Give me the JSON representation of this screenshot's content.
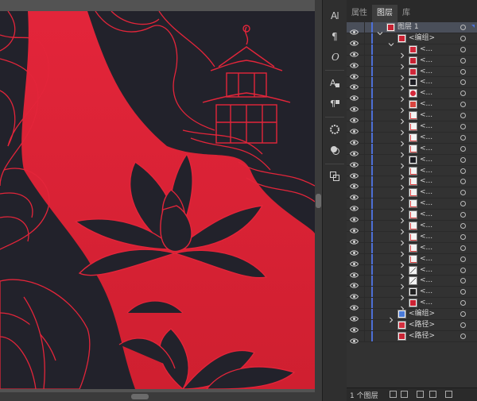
{
  "tabs": [
    {
      "label": "属性",
      "active": false
    },
    {
      "label": "图层",
      "active": true
    },
    {
      "label": "库",
      "active": false
    }
  ],
  "tools": [
    {
      "name": "character-tool-icon",
      "glyph": "A"
    },
    {
      "name": "paragraph-tool-icon",
      "glyph": "¶"
    },
    {
      "name": "opentype-tool-icon",
      "glyph": "O"
    },
    {
      "name": "char-styles-icon",
      "glyph": "A"
    },
    {
      "name": "para-styles-icon",
      "glyph": "¶"
    },
    {
      "name": "symbols-icon",
      "glyph": "✲"
    },
    {
      "name": "appearance-icon",
      "glyph": "●"
    },
    {
      "name": "transform-icon",
      "glyph": "⧉"
    }
  ],
  "layers": {
    "top_layer": {
      "label": "图层 1",
      "expanded": true
    },
    "group_top": {
      "label": "<编组>",
      "expanded": true
    },
    "sub_items": [
      {
        "label": "<...",
        "mark": "red-cloud"
      },
      {
        "label": "<...",
        "mark": "red-lotus"
      },
      {
        "label": "<...",
        "mark": "red-cloud"
      },
      {
        "label": "<...",
        "mark": "black-blob"
      },
      {
        "label": "<...",
        "mark": "red-disc"
      },
      {
        "label": "<...",
        "mark": "red-wave"
      },
      {
        "label": "<...",
        "mark": "red-sketch"
      },
      {
        "label": "<...",
        "mark": "red-sketch"
      },
      {
        "label": "<...",
        "mark": "red-sketch"
      },
      {
        "label": "<...",
        "mark": "red-sketch"
      },
      {
        "label": "<...",
        "mark": "black-blob"
      },
      {
        "label": "<...",
        "mark": "red-sketch"
      },
      {
        "label": "<...",
        "mark": "red-sketch"
      },
      {
        "label": "<...",
        "mark": "red-sketch"
      },
      {
        "label": "<...",
        "mark": "red-sketch"
      },
      {
        "label": "<...",
        "mark": "red-sketch"
      },
      {
        "label": "<...",
        "mark": "red-sketch"
      },
      {
        "label": "<...",
        "mark": "red-sketch"
      },
      {
        "label": "<...",
        "mark": "red-sketch"
      },
      {
        "label": "<...",
        "mark": "red-sketch"
      },
      {
        "label": "<...",
        "mark": "black-diag"
      },
      {
        "label": "<...",
        "mark": "black-diag"
      },
      {
        "label": "<...",
        "mark": "black-figure"
      },
      {
        "label": "<...",
        "mark": "red-bar"
      }
    ],
    "bottom_items": [
      {
        "label": "<编组>",
        "mark": "blue-wave",
        "expandable": true
      },
      {
        "label": "<路径>",
        "mark": "red-splash",
        "expandable": false
      },
      {
        "label": "<路径>",
        "mark": "red-blob",
        "expandable": false
      }
    ]
  },
  "footer": {
    "count": "1 个图层"
  }
}
